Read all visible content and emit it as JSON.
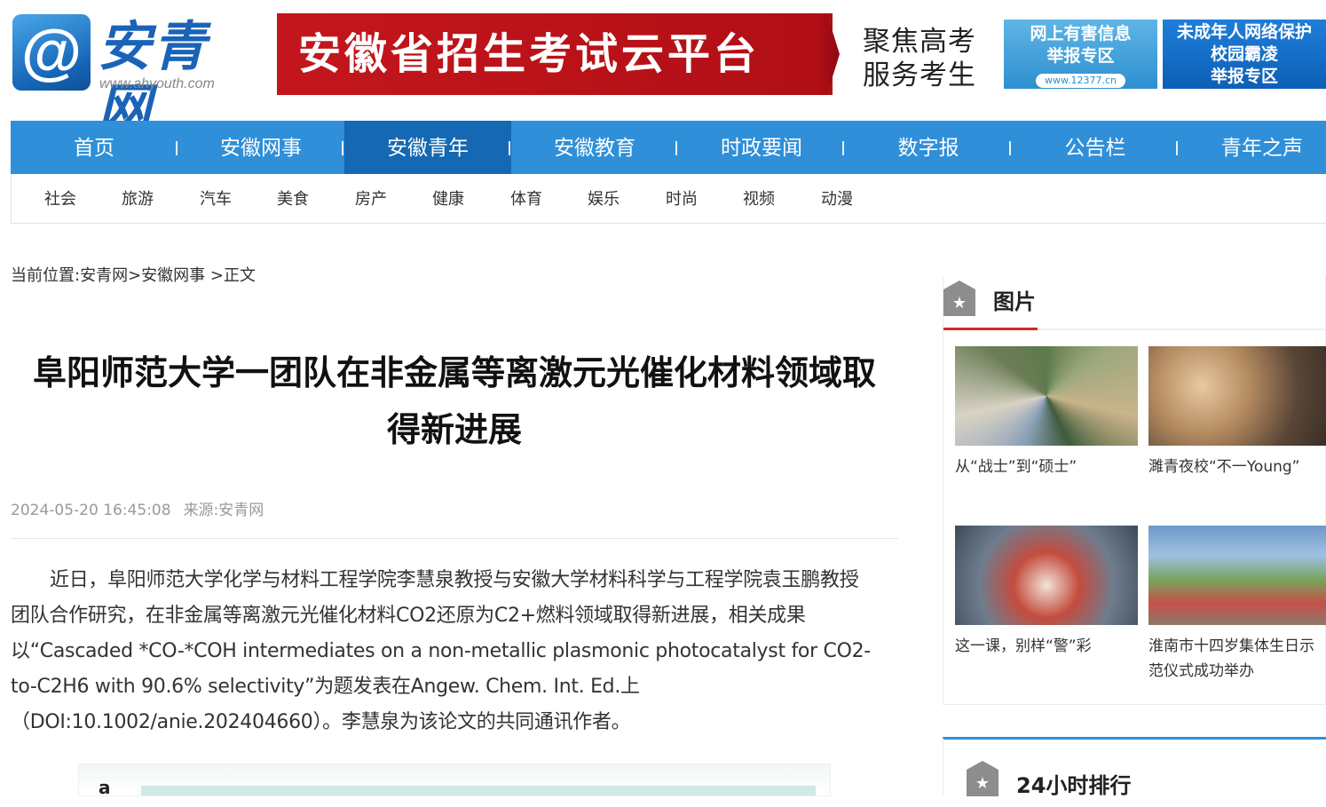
{
  "header": {
    "logo_glyph": "@",
    "logo_name": "安青网",
    "logo_url": "www.ahyouth.com",
    "banner_main": "安徽省招生考试云平台",
    "banner_side_line1": "聚焦高考",
    "banner_side_line2": "服务考生",
    "badge1_line1": "网上有害信息",
    "badge1_line2": "举报专区",
    "badge1_url": "www.12377.cn",
    "badge2_line1": "未成年人网络保护",
    "badge2_line2": "校园霸凌",
    "badge2_line3": "举报专区"
  },
  "nav": {
    "items": [
      "首页",
      "安徽网事",
      "安徽青年",
      "安徽教育",
      "时政要闻",
      "数字报",
      "公告栏",
      "青年之声"
    ],
    "active_index": 2
  },
  "subnav": {
    "items": [
      "社会",
      "旅游",
      "汽车",
      "美食",
      "房产",
      "健康",
      "体育",
      "娱乐",
      "时尚",
      "视频",
      "动漫"
    ]
  },
  "breadcrumb": {
    "prefix": "当前位置:",
    "path": "安青网>安徽网事 >正文"
  },
  "article": {
    "title_line1": "阜阳师范大学一团队在非金属等离激元光催化材料领域取",
    "title_line2": "得新进展",
    "date": "2024-05-20 16:45:08",
    "source": "来源:安青网",
    "paragraph_line1": "近日，阜阳师范大学化学与材料工程学院李慧泉教授与安徽大学材料科学与工程学院袁玉鹏教授",
    "paragraph_line2": "团队合作研究，在非金属等离激元光催化材料CO2还原为C2+燃料领域取得新进展，相关成果",
    "paragraph_line3": "以“Cascaded *CO-*COH intermediates on a non-metallic plasmonic photocatalyst for CO2-",
    "paragraph_line4": "to-C2H6 with 90.6% selectivity”为题发表在Angew. Chem. Int. Ed.上",
    "paragraph_line5": "（DOI:10.1002/anie.202404660）。李慧泉为该论文的共同通讯作者。",
    "figure_label": "a"
  },
  "sidebar": {
    "pictures_title": "图片",
    "pictures": [
      {
        "caption": "从“战士”到“硕士”"
      },
      {
        "caption": "濉青夜校“不一Young”"
      },
      {
        "caption": "这一课，别样“警”彩"
      },
      {
        "caption": "淮南市十四岁集体生日示范仪式成功举办"
      }
    ],
    "ranking_title": "24小时排行",
    "star_icon": "★"
  },
  "colors": {
    "nav_blue": "#2f8fd8",
    "nav_active": "#1568b3",
    "banner_red": "#c3161c",
    "accent_red": "#d6262b"
  }
}
